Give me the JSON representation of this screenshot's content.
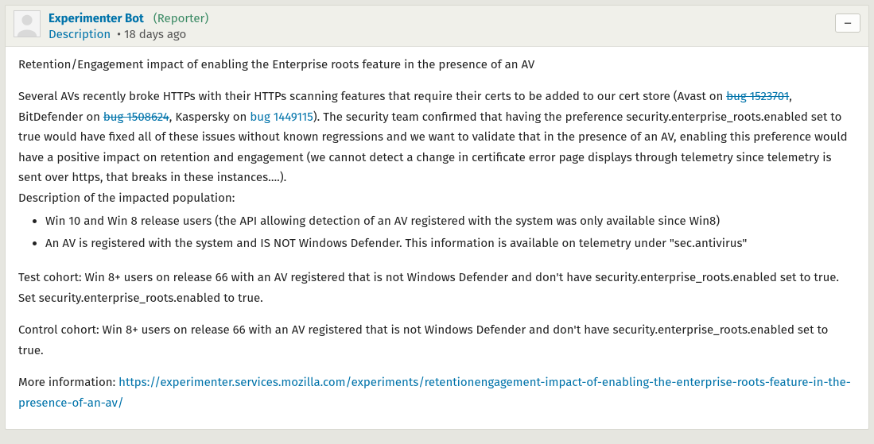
{
  "header": {
    "author": "Experimenter Bot",
    "reporter_badge": "(Reporter)",
    "description_label": "Description",
    "timestamp": "18 days ago",
    "collapse_label": "–"
  },
  "body": {
    "title": "Retention/Engagement impact of enabling the Enterprise roots feature in the presence of an AV",
    "p1_a": "Several AVs recently broke HTTPs with their HTTPs scanning features that require their certs to be added to our cert store (Avast on ",
    "bug1": "bug 1523701",
    "p1_b": ", BitDefender on ",
    "bug2": "bug 1508624",
    "p1_c": ", Kaspersky on ",
    "bug3": "bug 1449115",
    "p1_d": "). The security team confirmed that having the preference security.enterprise_roots.enabled set to true would have fixed all of these issues without known regressions and we want to validate that in the presence of an AV, enabling this preference would have a positive impact on retention and engagement (we cannot detect a change in certificate error page displays through telemetry since telemetry is sent over https, that breaks in these instances….).",
    "pop_label": "Description of the impacted population:",
    "bullets": [
      "Win 10 and Win 8 release users (the API allowing detection of an AV registered with the system was only available since Win8)",
      "An AV is registered with the system and IS NOT Windows Defender. This information is available on telemetry under \"sec.antivirus\""
    ],
    "test_cohort": "Test cohort: Win 8+ users on release 66 with an AV registered that is not Windows Defender and don't have security.enterprise_roots.enabled set to true. Set security.enterprise_roots.enabled to true.",
    "control_cohort": "Control cohort: Win 8+ users on release 66 with an AV registered that is not Windows Defender and don't have security.enterprise_roots.enabled set to true.",
    "more_info_label": "More information: ",
    "more_info_url": "https://experimenter.services.mozilla.com/experiments/retentionengagement-impact-of-enabling-the-enterprise-roots-feature-in-the-presence-of-an-av/"
  }
}
